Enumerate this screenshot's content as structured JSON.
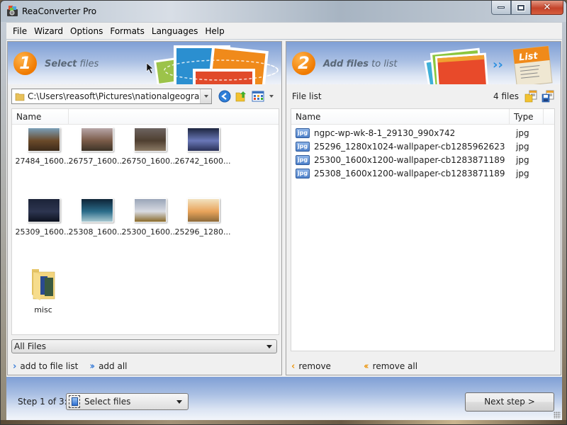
{
  "window": {
    "title": "ReaConverter Pro",
    "controls": {
      "minimize": "minimize",
      "maximize": "maximize",
      "close": "close"
    }
  },
  "menu": [
    "File",
    "Wizard",
    "Options",
    "Formats",
    "Languages",
    "Help"
  ],
  "step1": {
    "number": "1",
    "title_bold": "Select",
    "title_rest": " files",
    "path": "C:\\Users\\reasoft\\Pictures\\nationalgeographic",
    "column_name": "Name",
    "items": [
      {
        "label": "27484_1600...",
        "kind": "image",
        "colors": [
          "#7a9fb8",
          "#6b4a2a",
          "#3b2a1a"
        ]
      },
      {
        "label": "26757_1600...",
        "kind": "image",
        "colors": [
          "#b7a6a8",
          "#7a5b48",
          "#3c3327"
        ]
      },
      {
        "label": "26750_1600...",
        "kind": "image",
        "colors": [
          "#6d6461",
          "#4f3f30",
          "#8b7a66"
        ]
      },
      {
        "label": "26742_1600...",
        "kind": "image",
        "colors": [
          "#1d2640",
          "#6a78b8",
          "#2a3156"
        ]
      },
      {
        "label": "25309_1600...",
        "kind": "image",
        "colors": [
          "#1b2338",
          "#2d3550",
          "#0d1220"
        ]
      },
      {
        "label": "25308_1600...",
        "kind": "image",
        "colors": [
          "#0e2436",
          "#2b6c8a",
          "#a8c8d0"
        ]
      },
      {
        "label": "25300_1600...",
        "kind": "image",
        "colors": [
          "#9aa5b8",
          "#d8dbe2",
          "#8a6a2a"
        ]
      },
      {
        "label": "25296_1280...",
        "kind": "image",
        "colors": [
          "#f2e2c0",
          "#e9a35a",
          "#8c6a3a"
        ]
      },
      {
        "label": "misc",
        "kind": "folder"
      }
    ],
    "filter": "All Files",
    "actions": {
      "add": "add to file list",
      "add_all": "add all"
    }
  },
  "step2": {
    "number": "2",
    "title_bold": "Add files",
    "title_rest": " to list",
    "list_label": "File list",
    "file_count": "4 files",
    "columns": {
      "name": "Name",
      "type": "Type"
    },
    "files": [
      {
        "icon": "jpg",
        "name": "ngpc-wp-wk-8-1_29130_990x742",
        "type": "jpg"
      },
      {
        "icon": "jpg",
        "name": "25296_1280x1024-wallpaper-cb1285962623",
        "type": "jpg"
      },
      {
        "icon": "jpg",
        "name": "25300_1600x1200-wallpaper-cb1283871189",
        "type": "jpg"
      },
      {
        "icon": "jpg",
        "name": "25308_1600x1200-wallpaper-cb1283871189",
        "type": "jpg"
      }
    ],
    "actions": {
      "remove": "remove",
      "remove_all": "remove all"
    }
  },
  "footer": {
    "step_label": "Step 1 of 3:",
    "step_select": "Select files",
    "next_button": "Next step >"
  },
  "colors": {
    "accent_orange": "#f07a00",
    "banner_blue": "#7f9fd5",
    "arrow_blue": "#3d7fd8",
    "arrow_orange": "#ec9a1a"
  }
}
